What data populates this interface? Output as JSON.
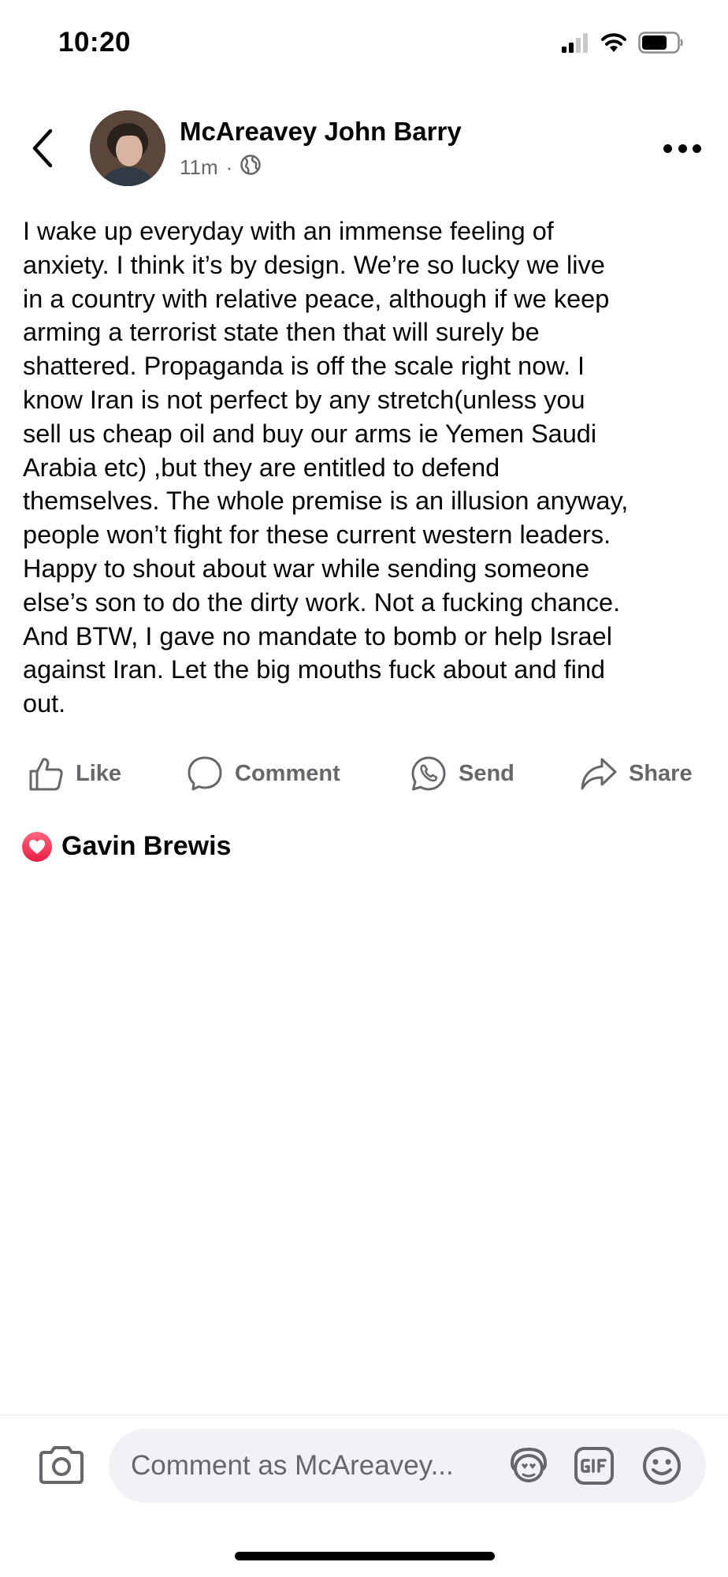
{
  "status_bar": {
    "time": "10:20",
    "icons": [
      "cellular-signal-icon",
      "wifi-icon",
      "battery-icon"
    ]
  },
  "post": {
    "author_name": "McAreavey John Barry",
    "time_ago": "11m",
    "meta_separator": "·",
    "privacy_icon": "globe-icon",
    "text": "I wake up everyday with an immense feeling of\nanxiety. I think it’s by design. We’re so lucky we live\nin a country with relative peace, although if we keep\narming a terrorist state then that will surely be\nshattered. Propaganda is off the scale right now. I\nknow Iran is not perfect by any stretch(unless you\nsell us cheap oil and buy our arms ie Yemen Saudi\nArabia etc) ,but they are entitled to defend\nthemselves. The whole premise is an illusion anyway,\npeople won’t fight for these current western leaders.\nHappy to shout about war while sending someone\nelse’s son to do the dirty work. Not a fucking chance.\nAnd BTW, I gave no mandate to bomb or help Israel\nagainst Iran. Let the big mouths fuck about and find\nout."
  },
  "actions": {
    "like": "Like",
    "comment": "Comment",
    "send": "Send",
    "share": "Share"
  },
  "reactions": {
    "type_icon": "heart-reaction-icon",
    "name": "Gavin Brewis"
  },
  "composer": {
    "placeholder": "Comment as McAreavey..."
  },
  "colors": {
    "text_primary": "#050505",
    "text_secondary": "#65676b",
    "composer_bg": "#f0f2f5",
    "love_reaction": "#f33e58"
  }
}
